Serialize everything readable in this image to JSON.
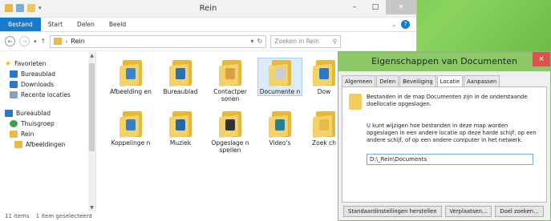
{
  "window": {
    "title": "Rein",
    "minimize_glyph": "–",
    "maximize_glyph": "□",
    "close_glyph": "×"
  },
  "ribbon": {
    "tabs": [
      "Bestand",
      "Start",
      "Delen",
      "Beeld"
    ]
  },
  "address": {
    "path_segment": "Rein",
    "search_placeholder": "Zoeken in Rein"
  },
  "navpane": {
    "items": [
      {
        "label": "Favorieten",
        "icon": "star-icon",
        "color": "#f0b422"
      },
      {
        "label": "Bureaublad",
        "icon": "desktop-icon",
        "color": "#2a78c8"
      },
      {
        "label": "Downloads",
        "icon": "downloads-icon",
        "color": "#2a78c8"
      },
      {
        "label": "Recente locaties",
        "icon": "recent-icon",
        "color": "#8aa0b8"
      },
      {
        "label": "Bureaublad",
        "icon": "desktop-icon",
        "color": "#2a78c8"
      },
      {
        "label": "Thuisgroep",
        "icon": "homegroup-icon",
        "color": "#3ca24a"
      },
      {
        "label": "Rein",
        "icon": "user-folder-icon",
        "color": "#e9b94a"
      },
      {
        "label": "Afbeeldingen",
        "icon": "pictures-icon",
        "color": "#e9b94a"
      }
    ]
  },
  "folders": [
    {
      "label": "Afbeelding en",
      "badge": "#3d86c6"
    },
    {
      "label": "Bureaublad",
      "badge": "#2b6fb4"
    },
    {
      "label": "Contactper sonen",
      "badge": "#d8a040"
    },
    {
      "label": "Documente n",
      "badge": "#c9ced6"
    },
    {
      "label": "Dow",
      "badge": "#2a78c8"
    },
    {
      "label": "Koppelinge n",
      "badge": "#3a7fc0"
    },
    {
      "label": "Muziek",
      "badge": "#2466a8"
    },
    {
      "label": "Opgeslage n spellen",
      "badge": "#333333"
    },
    {
      "label": "Video's",
      "badge": "#26809a"
    },
    {
      "label": "Zoek ch",
      "badge": "#e9b94a"
    }
  ],
  "status": {
    "items": "11 items",
    "selected": "1 item geselecteerd"
  },
  "dialog": {
    "title": "Eigenschappen van Documenten",
    "tabs": [
      "Algemeen",
      "Delen",
      "Beveiliging",
      "Locatie",
      "Aanpassen"
    ],
    "active_tab": "Locatie",
    "info_text": "Bestanden in de map Documenten zijn in de onderstaande doellocatie opgeslagen.",
    "desc_text": "U kunt wijzigen hoe bestanden in deze map worden opgeslagen in een andere locatie op deze harde schijf, op een andere schijf, of op een andere computer in het netwerk.",
    "path_value": "D:\\_Rein\\Documents",
    "buttons": [
      "Standaardinstellingen herstellen",
      "Verplaatsen...",
      "Doel zoeken..."
    ]
  }
}
